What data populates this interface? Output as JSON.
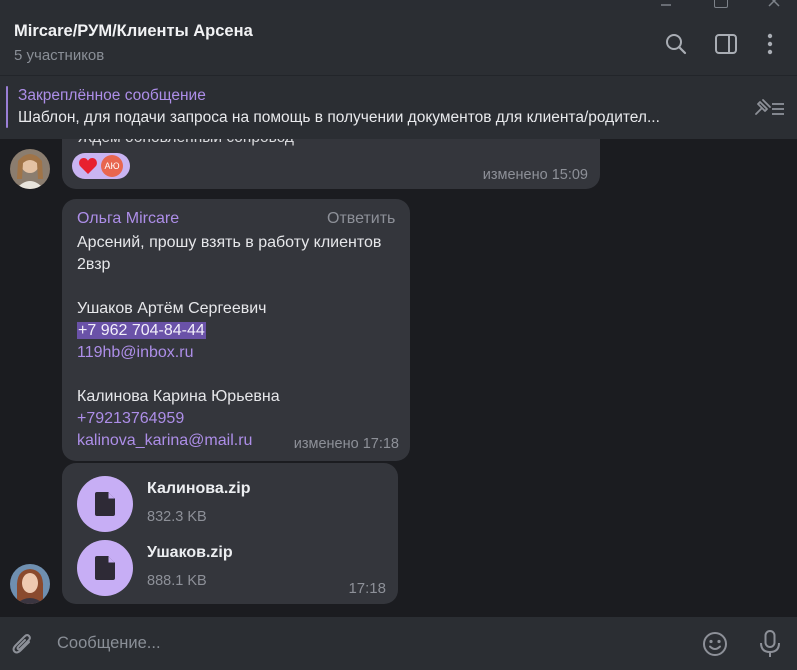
{
  "header": {
    "title": "Mircare/РУМ/Клиенты Арсена",
    "subtitle": "5 участников",
    "icons": [
      "search-icon",
      "sidebar-toggle-icon",
      "more-vertical-icon"
    ]
  },
  "pinned": {
    "title": "Закреплённое сообщение",
    "text": "Шаблон, для подачи запроса на помощь в получении документов для клиента/родител..."
  },
  "messages": [
    {
      "text": "Ждем обновленный сопровод",
      "reaction_emoji": "heart",
      "reaction_user_initials": "АЮ",
      "time": "изменено 15:09"
    },
    {
      "sender": "Ольга Mircare",
      "reply_label": "Ответить",
      "lines": [
        "Арсений, прошу взять в работу клиентов",
        "2взр",
        "",
        "Ушаков Артём Сергеевич",
        "+7 962 704-84-44",
        "119hb@inbox.ru",
        "",
        "Калинова Карина Юрьевна",
        "+79213764959",
        "kalinova_karina@mail.ru"
      ],
      "time": "изменено 17:18"
    },
    {
      "files": [
        {
          "name": "Калинова.zip",
          "size": "832.3 KB"
        },
        {
          "name": "Ушаков.zip",
          "size": "888.1 KB"
        }
      ],
      "time": "17:18"
    }
  ],
  "input": {
    "placeholder": "Сообщение..."
  },
  "colors": {
    "accent": "#ad8ee8",
    "bubble": "#34363c",
    "background": "#1b1c20",
    "header": "#2b2e33"
  }
}
